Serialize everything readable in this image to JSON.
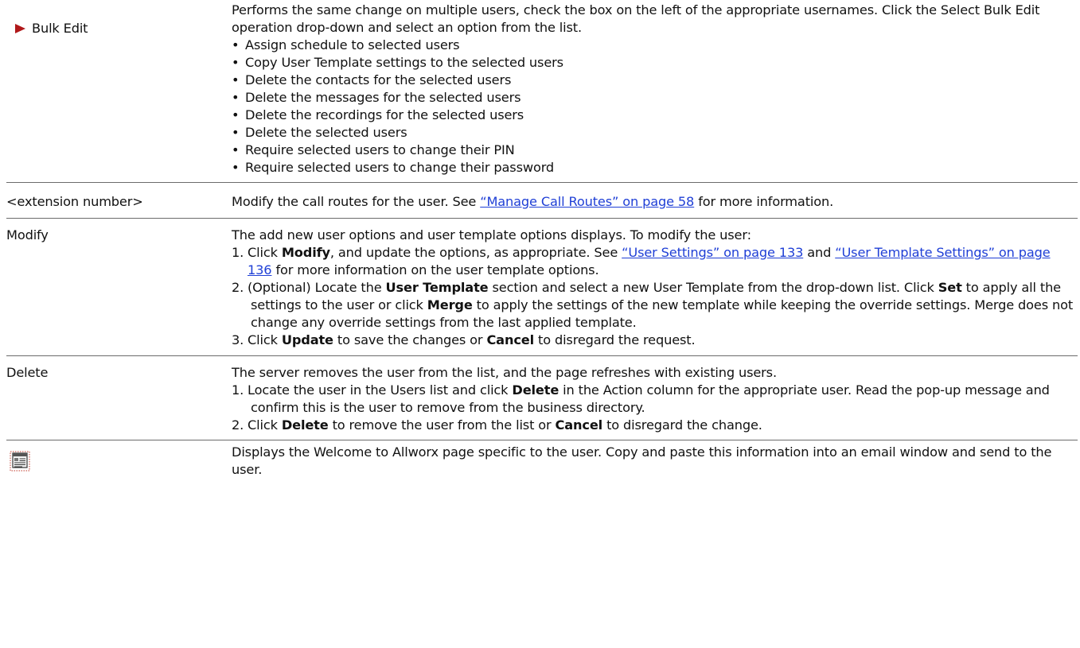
{
  "rows": {
    "bulk_edit": {
      "label": "Bulk Edit",
      "description": "Performs the same change on multiple users, check the box on the left of the appropriate usernames. Click the Select Bulk Edit operation drop-down and select an option from the list.",
      "options": [
        "Assign schedule to selected users",
        "Copy User Template settings to the selected users",
        "Delete the contacts for the selected users",
        "Delete the messages for the selected users",
        "Delete the recordings for the selected users",
        "Delete the selected users",
        "Require selected users to change their PIN",
        "Require selected users to change their password"
      ]
    },
    "extension": {
      "label": "<extension number>",
      "text_before": "Modify the call routes for the user. See ",
      "link": "“Manage Call Routes” on page 58",
      "text_after": " for more information."
    },
    "modify": {
      "label": "Modify",
      "intro": "The add new user options and user template options displays. To modify the user:",
      "step1": {
        "num": "1.",
        "a": "Click ",
        "bold1": "Modify",
        "b": ", and update the options, as appropriate. See ",
        "link1": "“User Settings” on page 133",
        "c": " and ",
        "link2": "“User Template Settings” on page 136",
        "d": " for more information on the user template options."
      },
      "step2": {
        "num": "2.",
        "a": "(Optional) Locate the ",
        "bold1": "User Template",
        "b": " section and select a new User Template from the drop-down list. Click ",
        "bold2": "Set",
        "c": " to apply all the settings to the user or click ",
        "bold3": "Merge",
        "d": " to apply the settings of the new template while keeping the override settings. Merge does not change any override settings from the last applied template."
      },
      "step3": {
        "num": "3.",
        "a": "Click ",
        "bold1": "Update",
        "b": " to save the changes or ",
        "bold2": "Cancel",
        "c": " to disregard the request."
      }
    },
    "delete": {
      "label": "Delete",
      "intro": "The server removes the user from the list, and the page refreshes with existing users.",
      "step1": {
        "num": "1.",
        "a": "Locate the user in the Users list and click ",
        "bold1": "Delete",
        "b": " in the Action column for the appropriate user. Read the pop-up message and confirm this is the user to remove from the business directory."
      },
      "step2": {
        "num": "2.",
        "a": "Click ",
        "bold1": "Delete",
        "b": " to remove the user from the list or ",
        "bold2": "Cancel",
        "c": " to disregard the change."
      }
    },
    "welcome": {
      "icon": "welcome-page-icon",
      "description": "Displays the Welcome to Allworx page specific to the user. Copy and paste this information into an email window and send to the user."
    }
  }
}
